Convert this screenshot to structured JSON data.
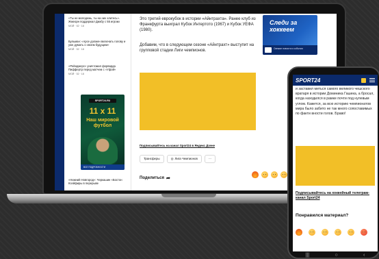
{
  "laptop": {
    "news": [
      {
        "text": "«Ты не молодежь, ты на них злитесь». Жжеорн поддержал Диабу с 55 игроки",
        "meta": "МОЙ  · 52  · 18"
      },
      {
        "text": "Бульман: «Арсе должен включать голову и уже думать о своем будущем»",
        "meta": "МОЙ  · 52  · 18"
      },
      {
        "text": "«Рейнджерс» уничтожил форварда Пиффертр перед матчем с «Уфой»",
        "meta": "МОЙ  · 52  · 18"
      },
      {
        "text": "«Нижний Новгород»: Черкашин «Бостон Ксейфиры в перерыве",
        "meta": ""
      }
    ],
    "promo": {
      "logo": "SPORT24.RU",
      "big": "11 x 11",
      "text": "Наш мировой футбол",
      "bottom": "ВСЕ ПОДРОБНОСТИ"
    },
    "article": {
      "p1": "Это третий еврокубок в истории «Айнтрахта». Ранее клуб из Франкфурта выиграл Кубок Интертото (1967) и Кубок УЕФА (1980).",
      "p2": "Добавим, что в следующем сезоне «Айнтрахт» выступит на групповой стадии Лиги чемпионов.",
      "subscribe": "Подписывайтесь на канал Sport24 в Яндекс Дзене",
      "tags": [
        "Трансферы",
        "Лига Чемпионов",
        "···"
      ],
      "share": "Поделиться"
    },
    "ad": {
      "title": "Следи за хоккеем",
      "bottom": "Свежие новости и события"
    }
  },
  "phone": {
    "logo": "SPORT24",
    "text": "и заставил меться самого великого чешского вратаря в истории Доминика Гашека, а бросал, когда находился в рамке почти под нулевым углом. Кажется, за всю историю чемпионатов мира было забито не так много сопоставимых по факти вности голов. Браво!",
    "subscribe": "Подписывайтесь на хоккейный телеграм-канал Sport24",
    "question": "Понравился материал?",
    "nav": [
      "|||",
      "○",
      "‹"
    ]
  },
  "colors": {
    "brand": "#0b2a6b",
    "accent": "#f2bf27"
  }
}
